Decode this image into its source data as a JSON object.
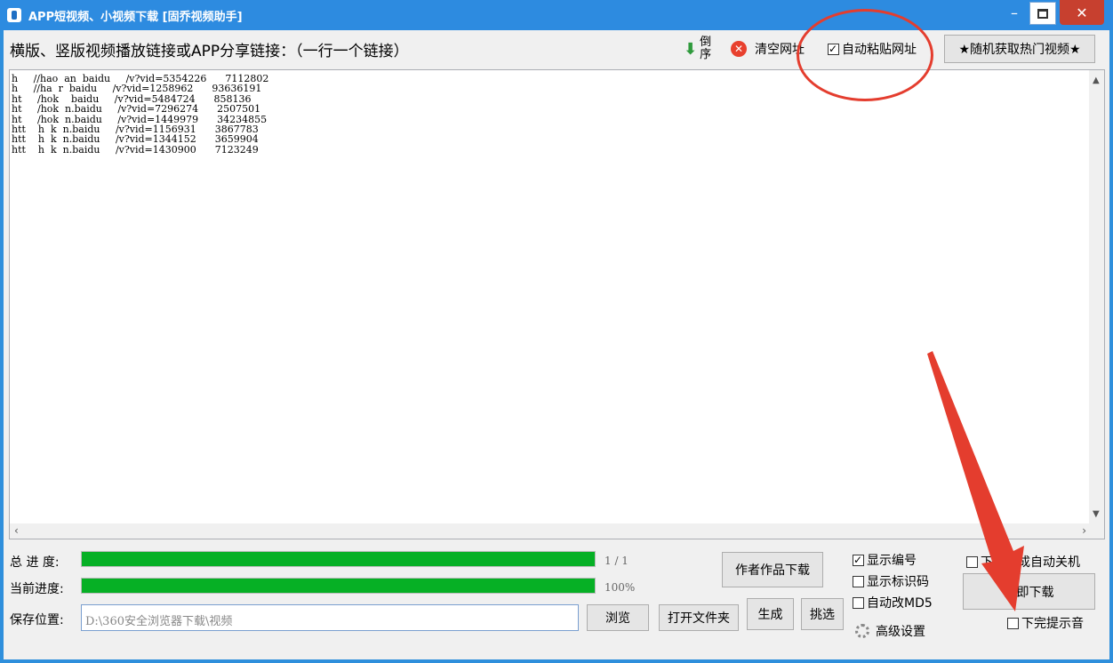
{
  "window": {
    "title": "APP短视频、小视频下载 [固乔视频助手]",
    "min_icon": "minimize-icon",
    "max_icon": "maximize-icon",
    "close_icon": "close-icon"
  },
  "header": {
    "label": "横版、竖版视频播放链接或APP分享链接：（一行一个链接）",
    "reverse_label": "倒序",
    "clear_label": "清空网址",
    "auto_paste_label": "自动粘贴网址",
    "auto_paste_checked": true,
    "hot_button_label": "★随机获取热门视频★"
  },
  "links": [
    "h     //hao  an  baidu     /v?vid=5354226      7112802",
    "h     //ha  r  baidu     /v?vid=1258962      93636191",
    "ht     /hok    baidu     /v?vid=5484724      858136",
    "ht     /hok  n.baidu     /v?vid=7296274      2507501",
    "ht     /hok  n.baidu     /v?vid=1449979      34234855",
    "htt    h  k  n.baidu     /v?vid=1156931      3867783",
    "htt    h  k  n.baidu     /v?vid=1344152      3659904",
    "htt    h  k  n.baidu     /v?vid=1430900      7123249"
  ],
  "progress": {
    "total_label": "总 进 度:",
    "total_value": "1 / 1",
    "total_fraction": 1.0,
    "current_label": "当前进度:",
    "current_value": "100%",
    "current_fraction": 1.0
  },
  "save": {
    "label": "保存位置:",
    "path": "D:\\360安全浏览器下载\\视频",
    "browse_label": "浏览",
    "open_folder_label": "打开文件夹"
  },
  "actions": {
    "author_label": "作者作品下载",
    "generate_label": "生成",
    "pick_label": "挑选",
    "download_label": "立即下载"
  },
  "options": {
    "show_number_label": "显示编号",
    "show_number_checked": true,
    "show_id_label": "显示标识码",
    "show_id_checked": false,
    "md5_label": "自动改MD5",
    "md5_checked": false,
    "advanced_label": "高级设置",
    "shutdown_label": "下载完成自动关机",
    "shutdown_checked": false,
    "sound_label": "下完提示音",
    "sound_checked": false
  },
  "colors": {
    "titlebar": "#2d8be0",
    "progress_fill": "#06b025",
    "annotation": "#e43d2e"
  }
}
